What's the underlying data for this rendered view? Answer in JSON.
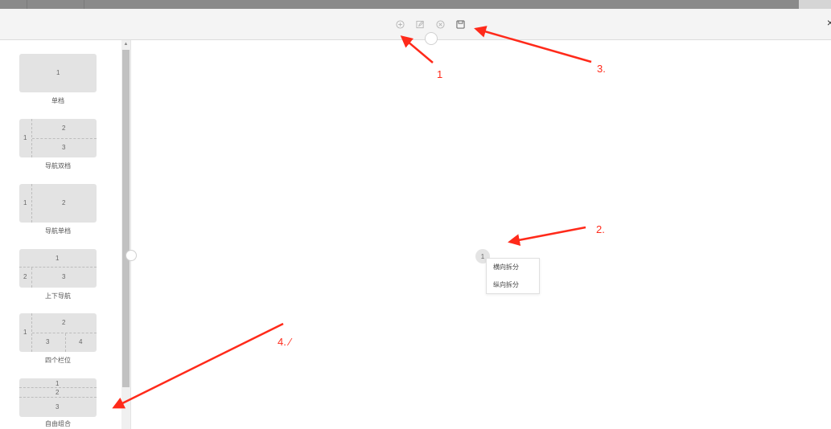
{
  "window": {
    "close_label": "×"
  },
  "toolbar": {
    "buttons": [
      {
        "name": "add-icon"
      },
      {
        "name": "edit-icon"
      },
      {
        "name": "clear-icon"
      },
      {
        "name": "save-icon"
      }
    ]
  },
  "layouts": [
    {
      "label": "单档",
      "cells": [
        "1"
      ]
    },
    {
      "label": "导航双档",
      "cells": [
        "1",
        "2",
        "3"
      ]
    },
    {
      "label": "导航单档",
      "cells": [
        "1",
        "2"
      ]
    },
    {
      "label": "上下导航",
      "cells": [
        "1",
        "2",
        "3"
      ]
    },
    {
      "label": "四个栏位",
      "cells": [
        "1",
        "2",
        "3",
        "4"
      ]
    },
    {
      "label": "自由组合",
      "cells": [
        "1",
        "2",
        "3"
      ]
    }
  ],
  "canvas": {
    "node_label": "1",
    "menu_items": [
      "横向拆分",
      "纵向拆分"
    ]
  },
  "annotations": {
    "label_1": "1",
    "label_2": "2.",
    "label_3": "3.",
    "label_4": "4. ⁄"
  },
  "colors": {
    "annotation": "#ff2a1a",
    "card_bg": "#e3e3e3",
    "toolbar_bg": "#f4f4f4"
  }
}
